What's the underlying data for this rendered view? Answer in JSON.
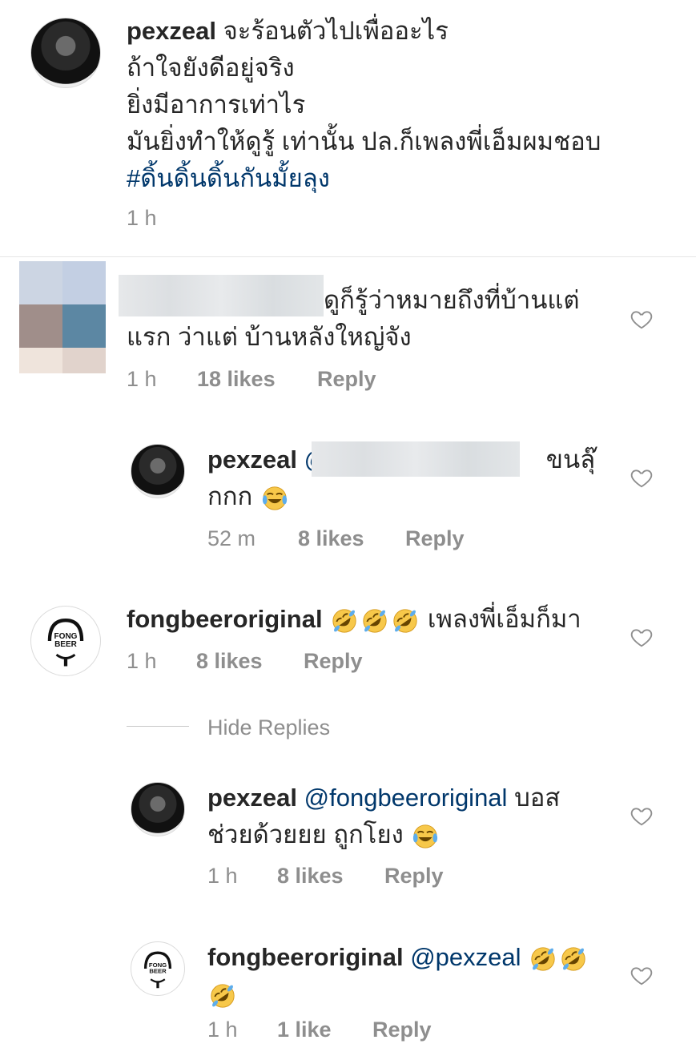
{
  "colors": {
    "text": "#262626",
    "muted": "#8e8e8e",
    "link": "#00376b"
  },
  "caption": {
    "user": "pexzeal",
    "line1": "จะร้อนตัวไปเพื่ออะไร",
    "line2": "ถ้าใจยังดีอยู่จริง",
    "line3": "ยิ่งมีอาการเท่าไร",
    "line4": "มันยิ่งทำให้ดูรู้ เท่านั้น ปล.ก็เพลงพี่เอ็มผมชอบ",
    "hashtag": "#ดิ้นดิ้นดิ้นกันมั้ยลุง",
    "time": "1 h"
  },
  "comments": [
    {
      "text1": "ดูก็รู้ว่าหมายถึงที่บ้านแต่",
      "text2": "แรก ว่าแต่ บ้านหลังใหญ่จัง",
      "time": "1 h",
      "likes": "18 likes",
      "reply": "Reply",
      "replies": [
        {
          "user": "pexzeal",
          "mention": "@",
          "text1": "ขนลุ๊",
          "text2": "กกก",
          "time": "52 m",
          "likes": "8 likes",
          "reply": "Reply",
          "emoji": "joy"
        }
      ]
    },
    {
      "user": "fongbeeroriginal",
      "text": "เพลงพี่เอ็มก็มา",
      "time": "1 h",
      "likes": "8 likes",
      "reply": "Reply",
      "hide": "Hide Replies",
      "replies": [
        {
          "user": "pexzeal",
          "mention": "@fongbeeroriginal",
          "text1": "บอส",
          "text2": "ช่วยด้วยยย ถูกโยง",
          "time": "1 h",
          "likes": "8 likes",
          "reply": "Reply",
          "emoji": "joy"
        },
        {
          "user": "fongbeeroriginal",
          "mention": "@pexzeal",
          "time": "1 h",
          "likes": "1 like",
          "reply": "Reply",
          "emoji": "rofl"
        }
      ]
    }
  ],
  "logo_text": {
    "top": "FONG",
    "bottom": "BEER"
  },
  "icons": {
    "heart": "heart-icon",
    "joy": "face-with-tears-of-joy-icon",
    "rofl": "rolling-on-floor-laughing-icon"
  }
}
